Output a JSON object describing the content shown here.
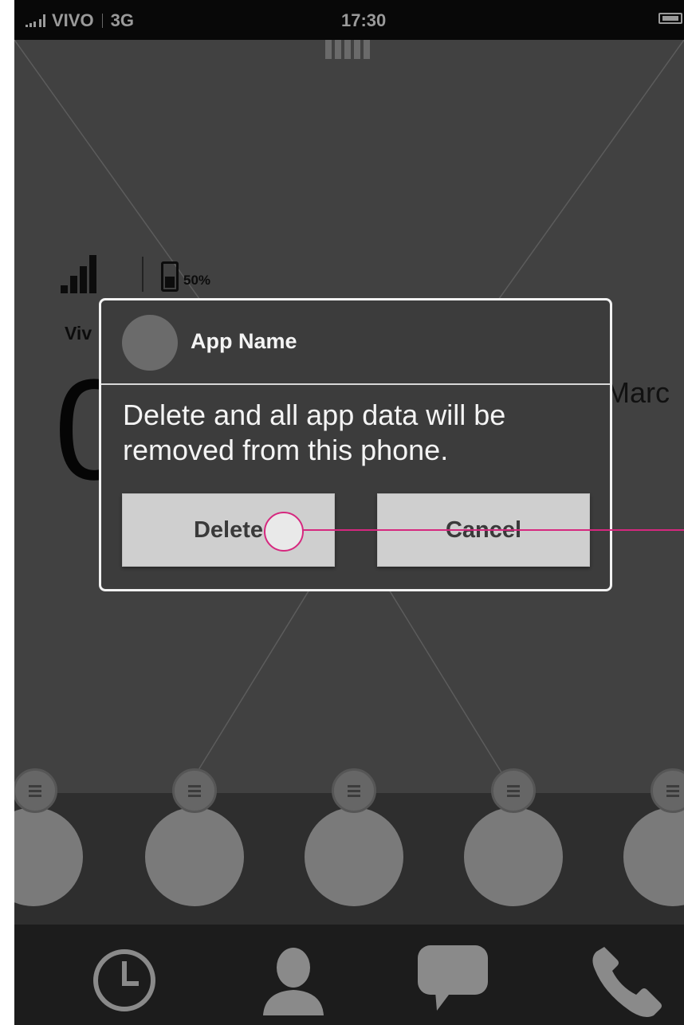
{
  "statusbar": {
    "carrier": "VIVO",
    "network": "3G",
    "time": "17:30"
  },
  "widget": {
    "battery_percent": "50%",
    "carrier_partial": "Viv",
    "clock_partial": "0",
    "month_partial": "Marc"
  },
  "dialog": {
    "app_name": "App Name",
    "message": "Delete and all app data will be removed from this phone.",
    "delete_label": "Delete",
    "cancel_label": "Cancel"
  },
  "tabbar": {
    "items": [
      {
        "icon": "clock-icon"
      },
      {
        "icon": "contact-icon"
      },
      {
        "icon": "chat-icon"
      },
      {
        "icon": "phone-icon"
      }
    ]
  },
  "colors": {
    "annotation": "#d6287f",
    "background": "#414141",
    "dialog_border": "#f2f2f2"
  }
}
